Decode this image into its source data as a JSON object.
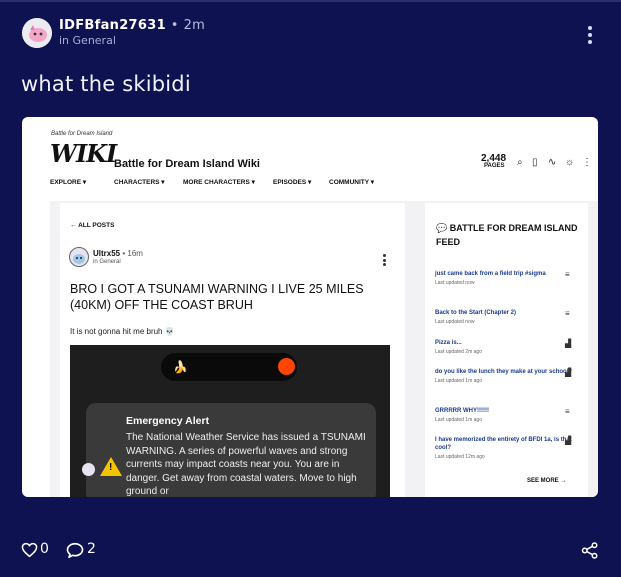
{
  "post": {
    "author": "IDFBfan27631",
    "separator": "•",
    "time": "2m",
    "community": "in General",
    "title": "what the skibidi",
    "likes": "0",
    "comments": "2"
  },
  "screenshot": {
    "wiki_tagline": "Battle for Dream Island",
    "wiki_logo": "WIKI",
    "wiki_name": "Battle for Dream Island Wiki",
    "pages_count": "2,448",
    "pages_label": "PAGES",
    "nav": [
      "EXPLORE ▾",
      "CHARACTERS ▾",
      "MORE CHARACTERS ▾",
      "EPISODES ▾",
      "COMMUNITY ▾"
    ],
    "all_posts": "← ALL POSTS",
    "inner_author": "Ultrx55",
    "inner_time": "• 16m",
    "inner_community": "in General",
    "inner_title": "BRO I GOT A TSUNAMI WARNING I LIVE 25 MILES (40KM) OFF THE COAST BRUH",
    "inner_body": "It is not gonna hit me bruh 💀",
    "alert_title": "Emergency Alert",
    "alert_text": "The National Weather Service has issued a TSUNAMI WARNING. A series of powerful waves and strong currents may impact coasts near you. You are in danger. Get away from coastal waters. Move to high ground or",
    "feed_title": "BATTLE FOR DREAM ISLAND FEED",
    "feed": [
      {
        "title": "just came back from a field trip #sigma",
        "sub": "Last updated now"
      },
      {
        "title": "Back to the Start (Chapter 2)",
        "sub": "Last updated now"
      },
      {
        "title": "Pizza is...",
        "sub": "Last updated 2m ago"
      },
      {
        "title": "do you like the lunch they make at your school?",
        "sub": "Last updated 1m ago"
      },
      {
        "title": "GRRRRR WHY!!!!!!",
        "sub": "Last updated 1m ago"
      },
      {
        "title": "I have memorized the entirety of BFDI 1a, is that cool?",
        "sub": "Last updated 12m ago"
      }
    ],
    "see_more": "SEE MORE →"
  },
  "icons": {
    "like": "heart-icon",
    "comment": "comment-icon",
    "share": "share-icon",
    "more": "more-vertical-icon"
  },
  "colors": {
    "background": "#0e1250",
    "text": "#ffffff",
    "feed_link": "#1a3a8f",
    "alert_icon": "#f5c400",
    "reddit_orange": "#ff4500"
  }
}
